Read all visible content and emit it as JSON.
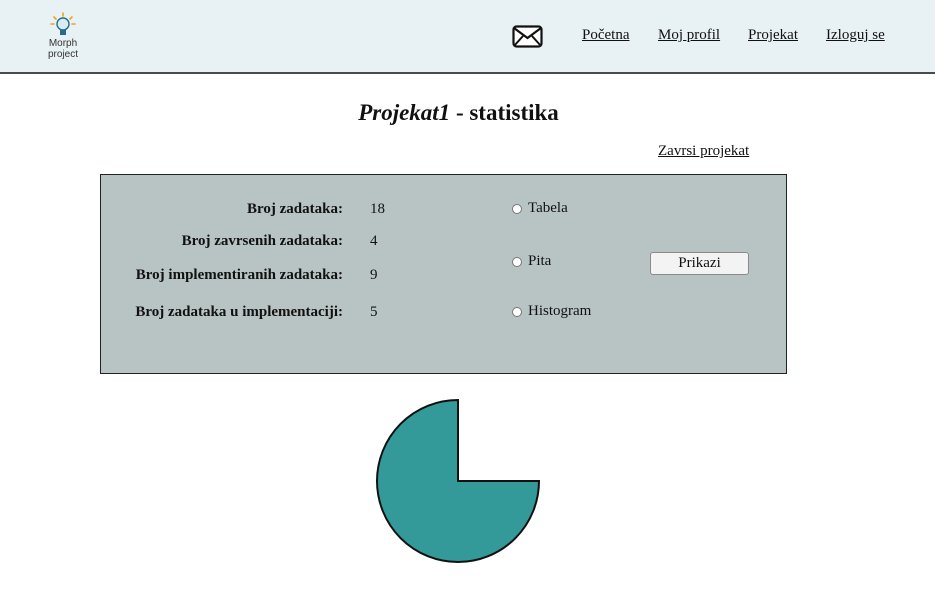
{
  "header": {
    "logo_text_line1": "Morph",
    "logo_text_line2": "project",
    "logo_icon": "lightbulb-icon",
    "mail_icon": "mail-icon",
    "nav": [
      "Početna",
      "Moj profil",
      "Projekat",
      "Izloguj se"
    ]
  },
  "page": {
    "project_name": "Projekat1",
    "title_suffix": " - statistika",
    "finish_link": "Zavrsi projekat"
  },
  "stats": [
    {
      "label": "Broj zadataka:",
      "value": "18"
    },
    {
      "label": "Broj zavrsenih zadataka:",
      "value": "4"
    },
    {
      "label": "Broj implementiranih zadataka:",
      "value": "9"
    },
    {
      "label": "Broj zadataka u implementaciji:",
      "value": "5"
    }
  ],
  "view_options": [
    "Tabela",
    "Pita",
    "Histogram"
  ],
  "show_button": "Prikazi",
  "colors": {
    "header_bg": "#e8f1f4",
    "panel_bg": "#b8c4c4",
    "pie_fill": "#339999"
  },
  "chart_data": {
    "type": "pie",
    "slices": [
      {
        "value": 0.75,
        "color": "#339999"
      },
      {
        "value": 0.25,
        "color": "#ffffff"
      }
    ]
  }
}
